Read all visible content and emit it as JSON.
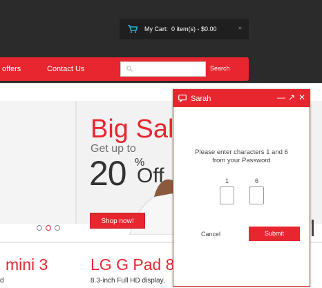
{
  "header": {
    "cart_label": "My Cart:",
    "cart_summary": "0 item(s) - $0.00"
  },
  "nav": {
    "items": [
      "offers",
      "Contact Us"
    ],
    "search_placeholder": "",
    "search_button": "Search"
  },
  "slider": {
    "headline": "Big Sale",
    "subline": "Get up to",
    "number": "20",
    "percent": "%",
    "off_word": "Off",
    "cta": "Shop now!"
  },
  "products": {
    "left_name": "mini 3",
    "left_sub": "d",
    "right_name": "LG G Pad 8",
    "right_sub": "8.3-inch Full HD display,"
  },
  "chat": {
    "title": "Sarah",
    "prompt_line1": "Please enter characters 1 and 6",
    "prompt_line2": "from your Password",
    "char1_label": "1",
    "char2_label": "6",
    "cancel": "Cancel",
    "submit": "Submit"
  },
  "colors": {
    "accent": "#e8262f",
    "header_bg": "#2b2b2b"
  },
  "icons": [
    "cart-icon",
    "chevron-down-icon",
    "search-icon",
    "chat-bubble-icon",
    "minimize-icon",
    "expand-icon",
    "close-icon"
  ]
}
